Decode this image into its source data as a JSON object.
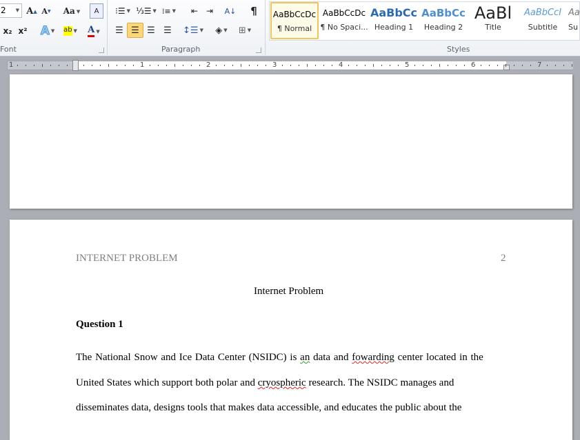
{
  "ribbon": {
    "font_group": {
      "label": "Font",
      "size_value": "2",
      "grow": "A",
      "shrink": "A",
      "change_case": "Aa",
      "subscript": "x₂",
      "superscript": "x²",
      "text_effects": "A",
      "highlight": "ab",
      "font_color": "A",
      "highlight_color": "#ffff00",
      "font_color_value": "#e00000"
    },
    "paragraph_group": {
      "label": "Paragraph",
      "show_marks": "¶",
      "sort": "A↓"
    },
    "styles_group": {
      "label": "Styles",
      "items": [
        {
          "preview": "AaBbCcDc",
          "name": "¶ Normal",
          "selected": true
        },
        {
          "preview": "AaBbCcDc",
          "name": "¶ No Spaci..."
        },
        {
          "preview": "AaBbCc",
          "name": "Heading 1"
        },
        {
          "preview": "AaBbCc",
          "name": "Heading 2"
        },
        {
          "preview": "AaBl",
          "name": "Title"
        },
        {
          "preview": "AaBbCcI",
          "name": "Subtitle"
        },
        {
          "preview": "Aa",
          "name": "Su"
        }
      ]
    }
  },
  "ruler": {
    "numbers": [
      "1",
      "1",
      "2",
      "3",
      "4",
      "5",
      "6",
      "7"
    ]
  },
  "page2": {
    "header_left": "INTERNET PROBLEM",
    "header_right": "2",
    "title": "Internet Problem",
    "heading": "Question 1",
    "line1": {
      "a": "The National Snow and Ice Data Center (NSIDC) is ",
      "b": "an",
      "c": " data and ",
      "d": "fowarding",
      "e": " center located in the"
    },
    "line2": {
      "a": "United States which support both polar and ",
      "b": "cryospheric",
      "c": " research. The NSIDC manages and"
    },
    "line3": "disseminates data, designs tools that makes data accessible, and educates the public about the"
  }
}
